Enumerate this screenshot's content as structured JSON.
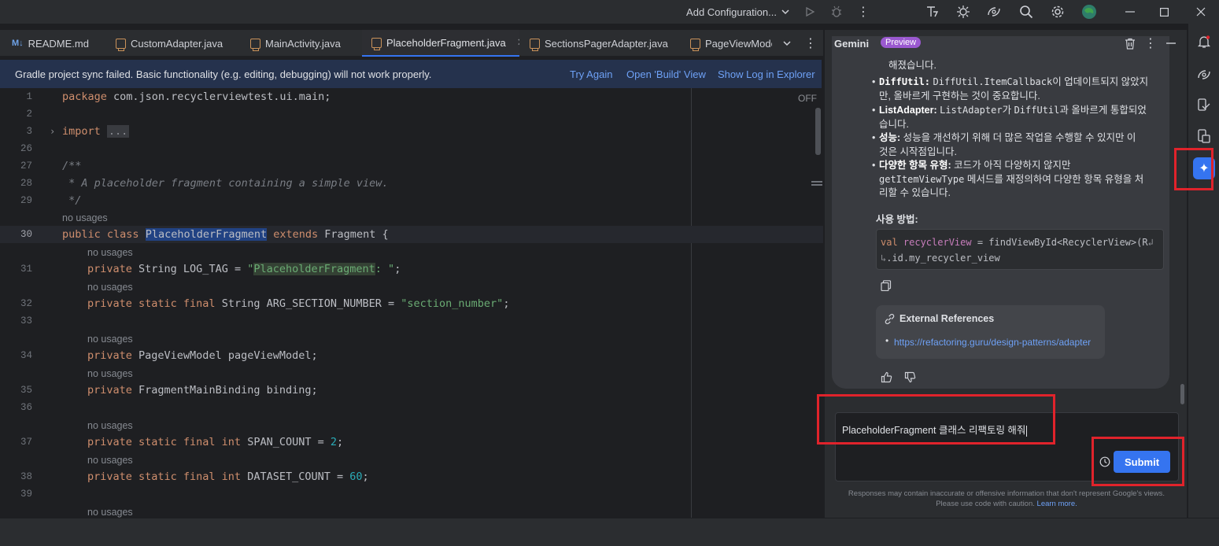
{
  "titlebar": {
    "run_config": "Add Configuration..."
  },
  "tabs": [
    {
      "label": "README.md",
      "active": false,
      "icon": "markdown-file-icon"
    },
    {
      "label": "CustomAdapter.java",
      "active": false,
      "icon": "java-file-icon"
    },
    {
      "label": "MainActivity.java",
      "active": false,
      "icon": "java-file-icon"
    },
    {
      "label": "PlaceholderFragment.java",
      "active": true,
      "icon": "java-file-icon"
    },
    {
      "label": "SectionsPagerAdapter.java",
      "active": false,
      "icon": "java-file-icon"
    },
    {
      "label": "PageViewMode",
      "active": false,
      "icon": "java-file-icon"
    }
  ],
  "banner": {
    "message": "Gradle project sync failed. Basic functionality (e.g. editing, debugging) will not work properly.",
    "links": [
      "Try Again",
      "Open 'Build' View",
      "Show Log in Explorer"
    ]
  },
  "editor": {
    "reader_mode": "OFF",
    "inlay_hint": "no usages",
    "line_numbers": [
      "1",
      "2",
      "3",
      "26",
      "27",
      "28",
      "29",
      "30",
      "31",
      "32",
      "33",
      "34",
      "35",
      "36",
      "37",
      "38",
      "39"
    ],
    "code": {
      "l1_kw": "package",
      "l1_rest": " com.json.recyclerviewtest.ui.main;",
      "l3_kw": "import",
      "l3_box": "...",
      "l27": "/**",
      "l28": " * A placeholder fragment containing a simple view.",
      "l29": " */",
      "l30_kw": "public class",
      "l30_name": "PlaceholderFragment",
      "l30_ext": "extends",
      "l30_rest": " Fragment {",
      "l31_kw": "private",
      "l31_type": " String LOG_TAG = ",
      "l31_q1": "\"",
      "l31_hl": "PlaceholderFragment",
      "l31_str": ": \"",
      "l31_end": ";",
      "l32_kw": "private static final",
      "l32_type": " String ARG_SECTION_NUMBER = ",
      "l32_str": "\"section_number\"",
      "l32_end": ";",
      "l34_kw": "private",
      "l34_rest": " PageViewModel pageViewModel;",
      "l35_kw": "private",
      "l35_rest": " FragmentMainBinding binding;",
      "l37_kw": "private static final int",
      "l37_rest": " SPAN_COUNT = ",
      "l37_num": "2",
      "l37_end": ";",
      "l38_kw": "private static final int",
      "l38_rest": " DATASET_COUNT = ",
      "l38_num": "60",
      "l38_end": ";"
    }
  },
  "gemini": {
    "title": "Gemini",
    "badge": "Preview",
    "partial_top": "해졌습니다.",
    "bullets": [
      {
        "term": "DiffUtil:",
        "mono": "DiffUtil.ItemCallback",
        "text1": "이 업데이트되지 않았지",
        "text2": "만, 올바르게 구현하는 것이 중요합니다."
      },
      {
        "term": "ListAdapter:",
        "mono": "ListAdapter",
        "text1": "가 ",
        "mono2": "DiffUtil",
        "text1b": "과 올바르게 통합되었",
        "text2": "습니다."
      },
      {
        "term": "성능:",
        "text1": "성능을 개선하기 위해 더 많은 작업을 수행할 수 있지만 이",
        "text2": "것은 시작점입니다."
      },
      {
        "term": "다양한 항목 유형:",
        "text1": "코드가 아직 다양하지 않지만",
        "mono": "getItemViewType",
        "text2a": " 메서드를 재정의하여 다양한 항목 유형을 처",
        "text3": "리할 수 있습니다."
      }
    ],
    "usage_title": "사용 방법:",
    "code_line1_kw": "val",
    "code_line1_var": " recyclerView",
    "code_line1_rest": " = findViewById<RecyclerView>(R",
    "code_line2": ".id.my_recycler_view",
    "refs_title": "External References",
    "refs_link": "https://refactoring.guru/design-patterns/adapter",
    "input_value": "PlaceholderFragment 클래스 리팩토링 해줘",
    "submit_label": "Submit",
    "disclaimer": "Responses may contain inaccurate or offensive information that don't represent Google's views. Please use code with caution.",
    "learn_more": "Learn more."
  },
  "colors": {
    "accent": "#3574f0",
    "annotation": "#e0232b",
    "badge": "#9b59d0"
  }
}
